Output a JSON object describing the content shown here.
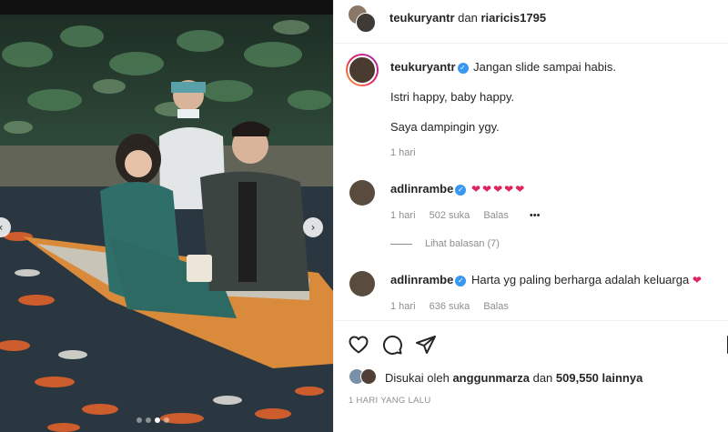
{
  "header": {
    "user1": "teukuryantr",
    "connector": "dan",
    "user2": "riaricis1795"
  },
  "caption": {
    "username": "teukuryantr",
    "line1": "Jangan slide sampai habis.",
    "line2": "Istri happy, baby happy.",
    "line3": "Saya dampingin ygy.",
    "time": "1 hari"
  },
  "comments": [
    {
      "username": "adlinrambe",
      "text": "❤❤❤❤❤",
      "time": "1 hari",
      "likes": "502 suka",
      "reply": "Balas",
      "more": "•••",
      "view_replies": "Lihat balasan (7)"
    },
    {
      "username": "adlinrambe",
      "text": "Harta yg paling berharga adalah keluarga",
      "emoji": "❤",
      "time": "1 hari",
      "likes": "636 suka",
      "reply": "Balas"
    }
  ],
  "likes": {
    "prefix": "Disukai oleh",
    "user": "anggunmarza",
    "connector": "dan",
    "count": "509,550 lainnya"
  },
  "timestamp": "1 HARI YANG LALU",
  "icons": {
    "verified": "verified-badge-icon",
    "like": "heart-icon",
    "comment": "comment-icon",
    "share": "send-icon",
    "save": "bookmark-icon"
  },
  "colors": {
    "accent": "#3897f0",
    "heart": "#e0245e",
    "muted": "#8e8e8e"
  }
}
